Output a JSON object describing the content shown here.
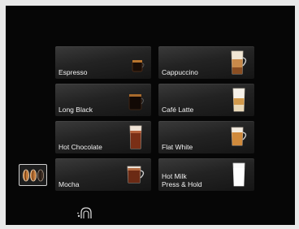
{
  "drinks": [
    {
      "label": "Espresso",
      "icon": "espresso-cup-icon"
    },
    {
      "label": "Cappuccino",
      "icon": "cappuccino-glass-icon"
    },
    {
      "label": "Long Black",
      "icon": "long-black-cup-icon"
    },
    {
      "label": "Café Latte",
      "icon": "latte-glass-icon"
    },
    {
      "label": "Hot Chocolate",
      "icon": "hot-chocolate-glass-icon"
    },
    {
      "label": "Flat White",
      "icon": "flat-white-glass-icon"
    },
    {
      "label": "Mocha",
      "icon": "mocha-glass-icon"
    },
    {
      "label": "Hot Milk\nPress & Hold",
      "icon": "hot-milk-glass-icon"
    }
  ],
  "controls": {
    "strength_icon": "coffee-beans-icon",
    "cleaning_icon": "cleaning-icon"
  }
}
